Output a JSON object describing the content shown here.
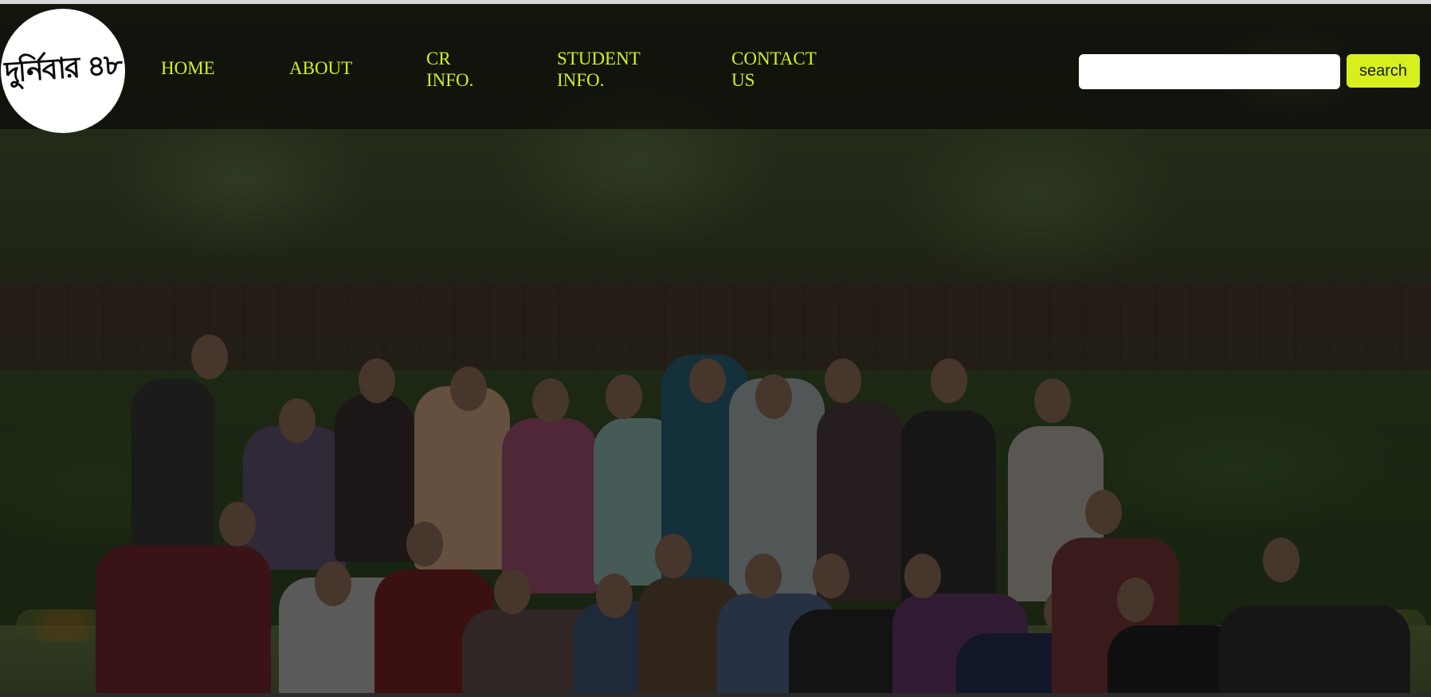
{
  "header": {
    "logo_text": "দুর্নিবার ৪৮"
  },
  "nav": {
    "items": [
      {
        "label": "HOME",
        "label_line2": ""
      },
      {
        "label": "ABOUT",
        "label_line2": ""
      },
      {
        "label": "CR",
        "label_line2": "INFO."
      },
      {
        "label": "STUDENT",
        "label_line2": "INFO."
      },
      {
        "label": "CONTACT",
        "label_line2": "US"
      }
    ]
  },
  "search": {
    "placeholder": "",
    "value": "",
    "button_label": "search"
  },
  "colors": {
    "accent": "#d7ef1e",
    "logo_bg": "#ffffff"
  },
  "hero": {
    "image": "group-photo"
  }
}
